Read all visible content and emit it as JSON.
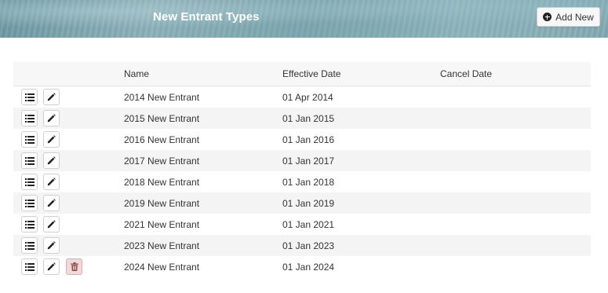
{
  "header": {
    "title": "New Entrant Types",
    "add_button_label": "Add New"
  },
  "table": {
    "columns": [
      "Name",
      "Effective Date",
      "Cancel Date"
    ],
    "rows": [
      {
        "name": "2014 New Entrant",
        "effective_date": "01 Apr 2014",
        "cancel_date": "",
        "can_delete": false
      },
      {
        "name": "2015 New Entrant",
        "effective_date": "01 Jan 2015",
        "cancel_date": "",
        "can_delete": false
      },
      {
        "name": "2016 New Entrant",
        "effective_date": "01 Jan 2016",
        "cancel_date": "",
        "can_delete": false
      },
      {
        "name": "2017 New Entrant",
        "effective_date": "01 Jan 2017",
        "cancel_date": "",
        "can_delete": false
      },
      {
        "name": "2018 New Entrant",
        "effective_date": "01 Jan 2018",
        "cancel_date": "",
        "can_delete": false
      },
      {
        "name": "2019 New Entrant",
        "effective_date": "01 Jan 2019",
        "cancel_date": "",
        "can_delete": false
      },
      {
        "name": "2021 New Entrant",
        "effective_date": "01 Jan 2021",
        "cancel_date": "",
        "can_delete": false
      },
      {
        "name": "2023 New Entrant",
        "effective_date": "01 Jan 2023",
        "cancel_date": "",
        "can_delete": false
      },
      {
        "name": "2024 New Entrant",
        "effective_date": "01 Jan 2024",
        "cancel_date": "",
        "can_delete": true
      }
    ]
  },
  "icons": {
    "add": "plus-circle-icon",
    "details": "list-icon",
    "edit": "pencil-icon",
    "delete": "trash-icon"
  },
  "colors": {
    "delete_button_bg": "#f2d9d9",
    "alt_row_bg": "#f4f4f4",
    "header_bg": "#82aab4"
  }
}
